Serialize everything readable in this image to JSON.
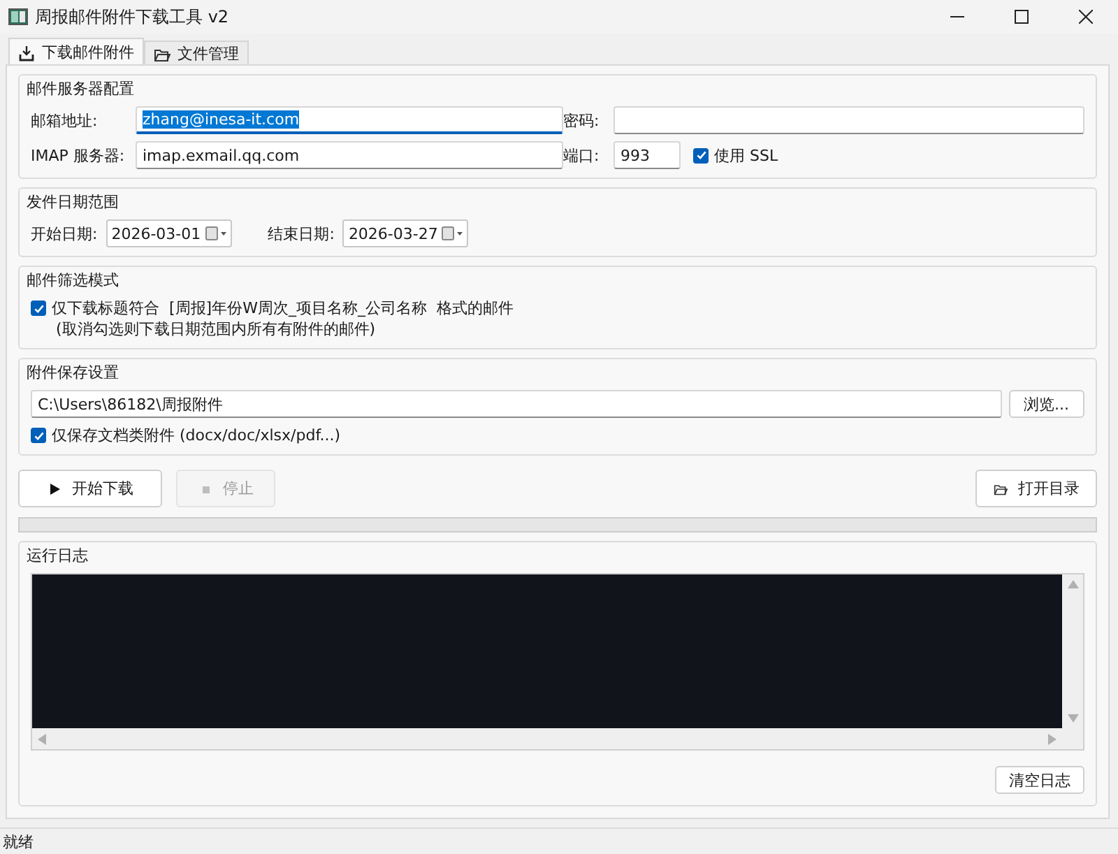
{
  "window": {
    "title": "周报邮件附件下载工具 v2"
  },
  "tabs": [
    {
      "label": "下载邮件附件",
      "kind": "download",
      "selected": true
    },
    {
      "label": "文件管理",
      "kind": "folder",
      "selected": false
    }
  ],
  "server": {
    "title": "邮件服务器配置",
    "email": {
      "label": "邮箱地址:",
      "value": "zhang@inesa-it.com",
      "focused": true
    },
    "password": {
      "label": "密码:"
    },
    "host": {
      "label": "IMAP 服务器:",
      "value": "imap.exmail.qq.com"
    },
    "port": {
      "label": "端口:",
      "value": "993"
    },
    "ssl": {
      "label": "使用 SSL",
      "checked": true
    }
  },
  "dates": {
    "title": "发件日期范围",
    "start": {
      "label": "开始日期:",
      "value": "2026-03-01"
    },
    "end": {
      "label": "结束日期:",
      "value": "2026-03-27"
    }
  },
  "filter": {
    "title": "邮件筛选模式",
    "checkbox": {
      "label": "仅下载标题符合  [周报]年份W周次_项目名称_公司名称  格式的邮件",
      "checked": true
    },
    "note": "(取消勾选则下载日期范围内所有有附件的邮件)"
  },
  "save": {
    "title": "附件保存设置",
    "path": "C:\\Users\\86182\\周报附件",
    "browse": "浏览...",
    "docs_only": {
      "label": "仅保存文档类附件 (docx/doc/xlsx/pdf...)",
      "checked": true
    }
  },
  "actions": [
    {
      "label": "开始下载",
      "kind": "play",
      "disabled": false
    },
    {
      "label": "停止",
      "kind": "stop",
      "disabled": true
    },
    {
      "label": "打开目录",
      "kind": "folder",
      "disabled": false
    }
  ],
  "progress": {
    "level": 0
  },
  "log": {
    "title": "运行日志",
    "clear": "清空日志"
  },
  "status_bar": "就绪"
}
